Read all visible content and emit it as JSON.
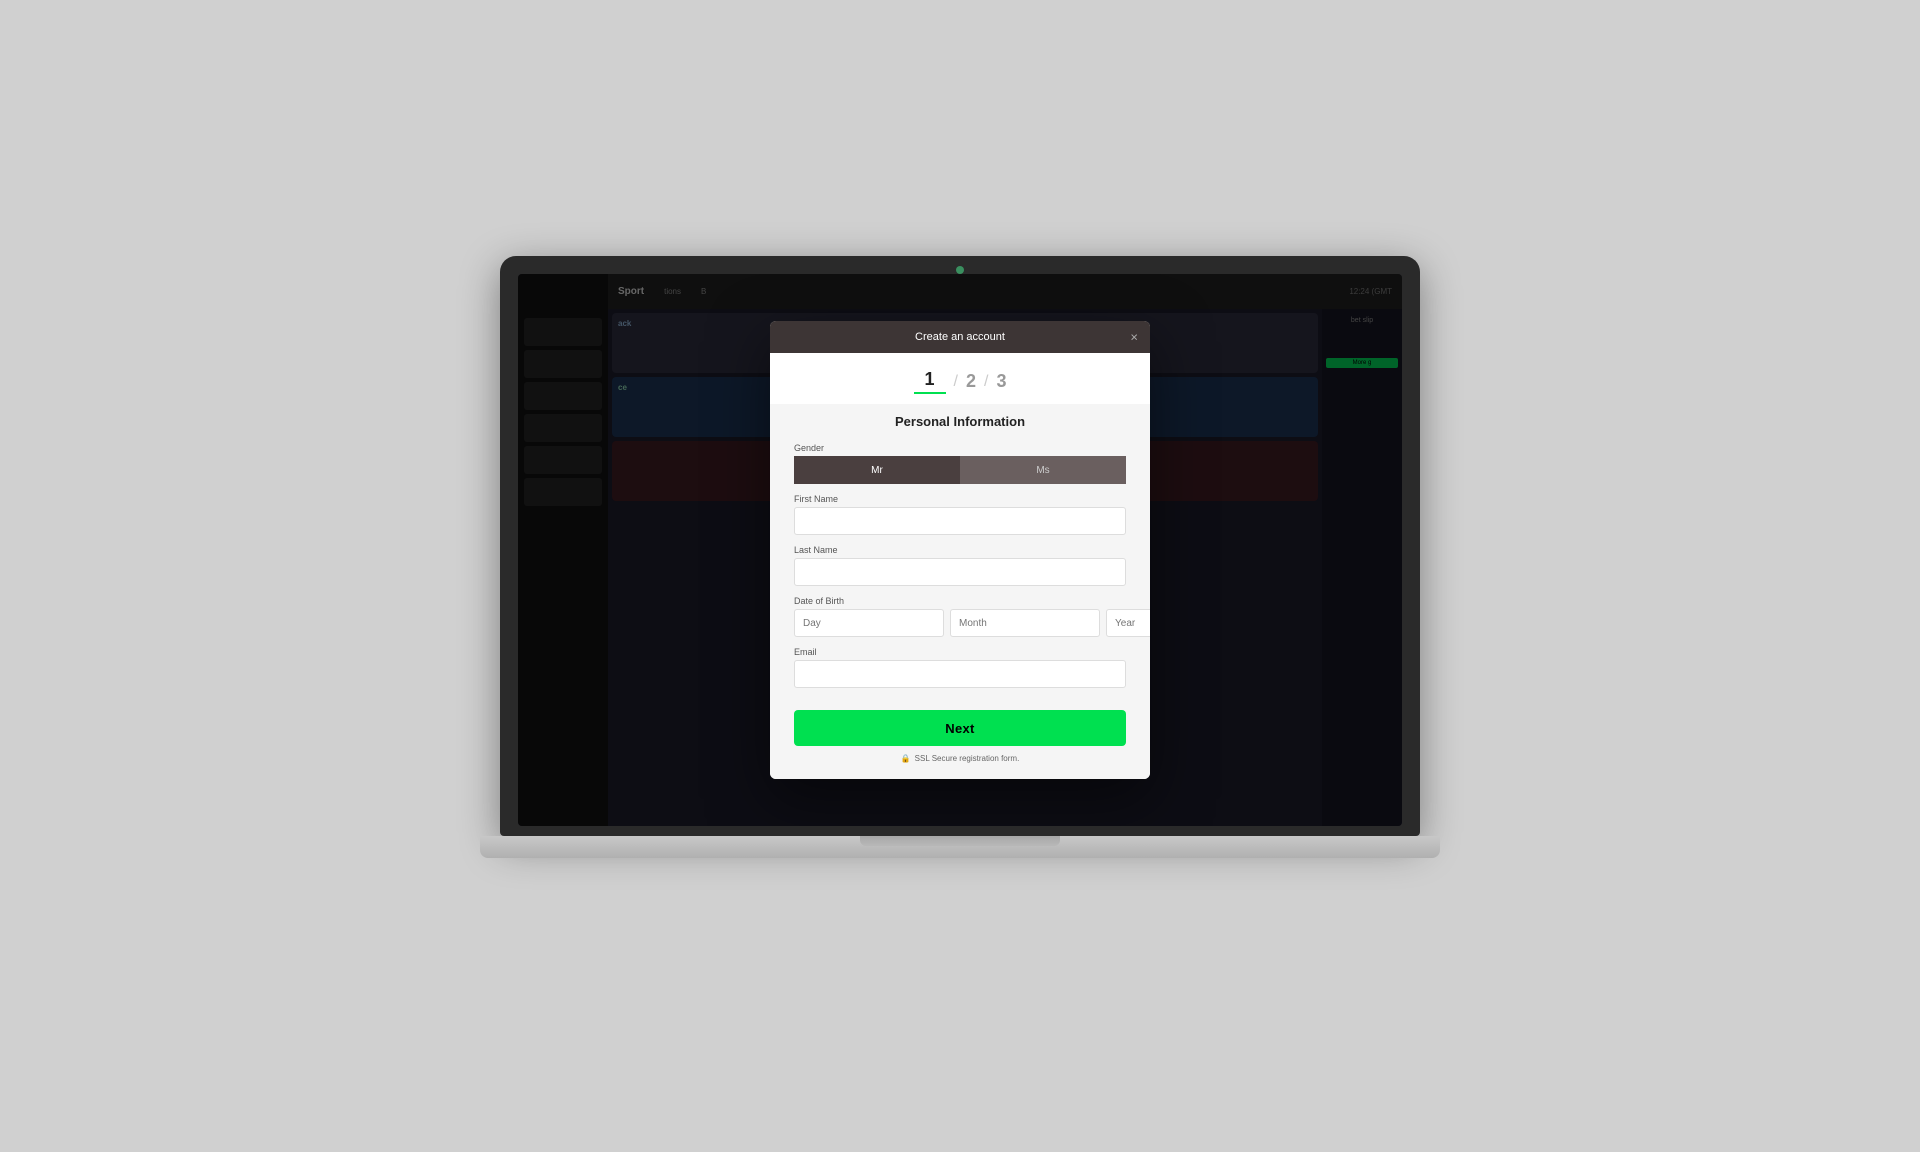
{
  "modal": {
    "title": "Create an account",
    "close_label": "×",
    "steps": [
      {
        "number": "1",
        "active": true
      },
      {
        "divider": "/"
      },
      {
        "number": "2",
        "active": false
      },
      {
        "divider": "/"
      },
      {
        "number": "3",
        "active": false
      }
    ],
    "form": {
      "section_title": "Personal Information",
      "gender_label": "Gender",
      "gender_mr": "Mr",
      "gender_ms": "Ms",
      "first_name_label": "First Name",
      "first_name_placeholder": "",
      "last_name_label": "Last Name",
      "last_name_placeholder": "",
      "dob_label": "Date of Birth",
      "dob_day_placeholder": "Day",
      "dob_month_placeholder": "Month",
      "dob_year_placeholder": "Year",
      "email_label": "Email",
      "email_placeholder": "",
      "next_button": "Next",
      "ssl_text": "SSL Secure registration form."
    }
  },
  "topbar": {
    "logo": "Sport",
    "nav_items": [
      "tions",
      "B"
    ],
    "time": "12:24  (GMT"
  }
}
